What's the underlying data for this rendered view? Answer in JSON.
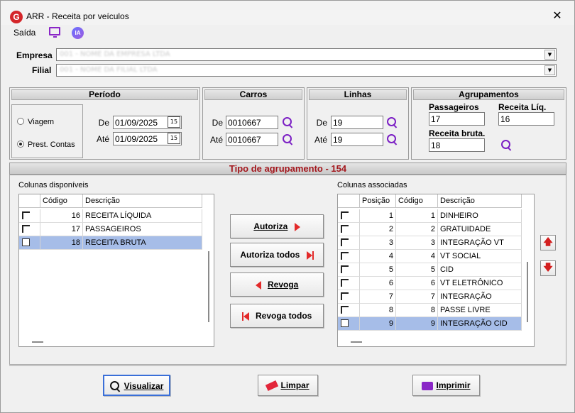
{
  "window": {
    "title": "ARR - Receita por veículos",
    "logo_letter": "G",
    "close": "✕"
  },
  "menu": {
    "saida": "Saída",
    "ia": "IA"
  },
  "filters": {
    "empresa_label": "Empresa",
    "empresa_value": "001 - NOME DA EMPRESA LTDA",
    "filial_label": "Filial",
    "filial_value": "001 - NOME DA FILIAL LTDA",
    "arrow": "▼"
  },
  "periodo": {
    "title": "Período",
    "opt_viagem": "Viagem",
    "opt_prest": "Prest. Contas",
    "selected": "Prest. Contas",
    "de_label": "De",
    "de_value": "01/09/2025",
    "ate_label": "Até",
    "ate_value": "01/09/2025",
    "cal": "15"
  },
  "carros": {
    "title": "Carros",
    "de_label": "De",
    "de_value": "0010667",
    "ate_label": "Até",
    "ate_value": "0010667"
  },
  "linhas": {
    "title": "Linhas",
    "de_label": "De",
    "de_value": "19",
    "ate_label": "Até",
    "ate_value": "19"
  },
  "agrupamentos": {
    "title": "Agrupamentos",
    "passageiros_label": "Passageiros",
    "passageiros_value": "17",
    "receita_liq_label": "Receita Líq.",
    "receita_liq_value": "16",
    "receita_bruta_label": "Receita bruta.",
    "receita_bruta_value": "18"
  },
  "band": {
    "text": "Tipo de agrupamento - 154"
  },
  "disponiveis": {
    "label": "Colunas disponíveis",
    "headers": {
      "codigo": "Código",
      "descricao": "Descrição"
    },
    "rows": [
      {
        "codigo": "16",
        "descricao": "RECEITA LÍQUIDA",
        "selected": false
      },
      {
        "codigo": "17",
        "descricao": "PASSAGEIROS",
        "selected": false
      },
      {
        "codigo": "18",
        "descricao": "RECEITA BRUTA",
        "selected": true
      }
    ]
  },
  "associadas": {
    "label": "Colunas associadas",
    "headers": {
      "posicao": "Posição",
      "codigo": "Código",
      "descricao": "Descrição"
    },
    "rows": [
      {
        "posicao": "1",
        "codigo": "1",
        "descricao": "DINHEIRO",
        "selected": false
      },
      {
        "posicao": "2",
        "codigo": "2",
        "descricao": "GRATUIDADE",
        "selected": false
      },
      {
        "posicao": "3",
        "codigo": "3",
        "descricao": "INTEGRAÇÃO VT",
        "selected": false
      },
      {
        "posicao": "4",
        "codigo": "4",
        "descricao": "VT SOCIAL",
        "selected": false
      },
      {
        "posicao": "5",
        "codigo": "5",
        "descricao": "CID",
        "selected": false
      },
      {
        "posicao": "6",
        "codigo": "6",
        "descricao": "VT ELETRÔNICO",
        "selected": false
      },
      {
        "posicao": "7",
        "codigo": "7",
        "descricao": "INTEGRAÇÃO",
        "selected": false
      },
      {
        "posicao": "8",
        "codigo": "8",
        "descricao": "PASSE LIVRE",
        "selected": false
      },
      {
        "posicao": "9",
        "codigo": "9",
        "descricao": "INTEGRAÇÃO CID",
        "selected": true
      }
    ]
  },
  "actions": {
    "autoriza": "Autoriza",
    "autoriza_todos": "Autoriza todos",
    "revoga": "Revoga",
    "revoga_todos": "Revoga todos",
    "up": "🡅",
    "down": "🡇"
  },
  "footer": {
    "visualizar": "Visualizar",
    "limpar": "Limpar",
    "imprimir": "Imprimir"
  },
  "colors": {
    "accent": "#7b1fc4",
    "red": "#e32a2a",
    "band_text": "#a3171d",
    "selection": "#a6bde8"
  }
}
